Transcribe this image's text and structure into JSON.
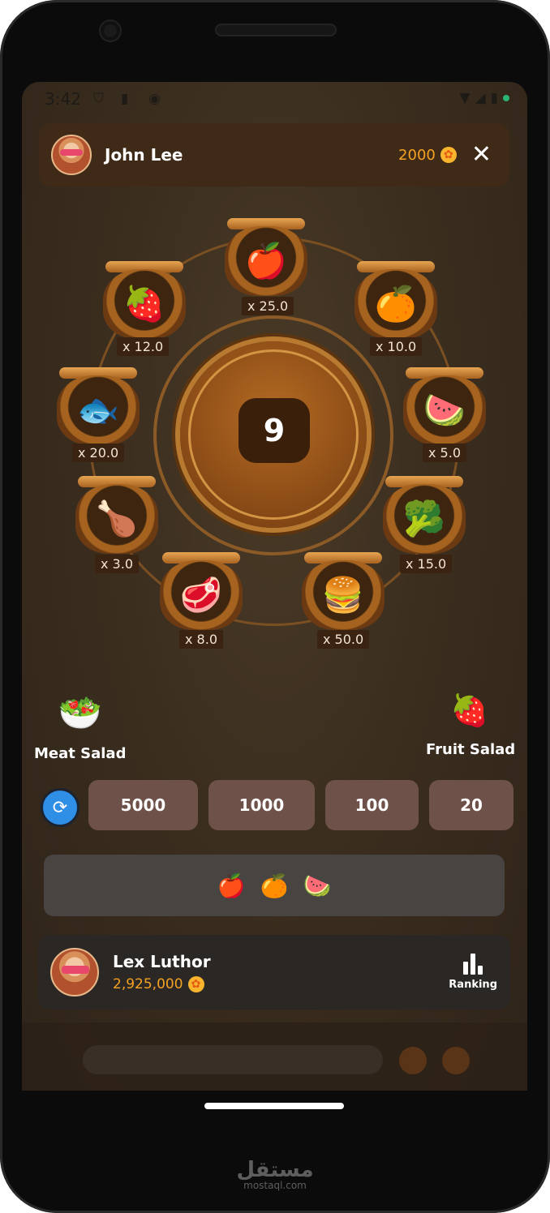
{
  "status_bar": {
    "time": "3:42"
  },
  "header": {
    "player_name": "John Lee",
    "coins": "2000",
    "close_symbol": "✕"
  },
  "wheel": {
    "counter": "9",
    "items": [
      {
        "name": "apple",
        "emoji": "🍎",
        "multiplier": "x 25.0"
      },
      {
        "name": "orange",
        "emoji": "🍊",
        "multiplier": "x 10.0"
      },
      {
        "name": "watermelon",
        "emoji": "🍉",
        "multiplier": "x 5.0"
      },
      {
        "name": "broccoli",
        "emoji": "🥦",
        "multiplier": "x 15.0"
      },
      {
        "name": "burger",
        "emoji": "🍔",
        "multiplier": "x 50.0"
      },
      {
        "name": "steak",
        "emoji": "🥩",
        "multiplier": "x 8.0"
      },
      {
        "name": "drumstick",
        "emoji": "🍗",
        "multiplier": "x 3.0"
      },
      {
        "name": "fish",
        "emoji": "🐟",
        "multiplier": "x 20.0"
      },
      {
        "name": "strawberry",
        "emoji": "🍓",
        "multiplier": "x 12.0"
      }
    ]
  },
  "salads": {
    "meat": {
      "label": "Meat Salad",
      "emoji": "🥗"
    },
    "fruit": {
      "label": "Fruit Salad",
      "emoji": "🍓"
    }
  },
  "bets": {
    "refresh_symbol": "⟳",
    "options": [
      "5000",
      "1000",
      "100",
      "20"
    ]
  },
  "history": [
    "🍎",
    "🍊",
    "🍉"
  ],
  "player": {
    "name": "Lex Luthor",
    "coins": "2,925,000",
    "ranking_label": "Ranking"
  },
  "watermark": {
    "logo": "مستقل",
    "site": "mostaql.com"
  },
  "colors": {
    "accent": "#f4a223",
    "bet_button": "#6e5149",
    "refresh": "#2f8ee5"
  }
}
